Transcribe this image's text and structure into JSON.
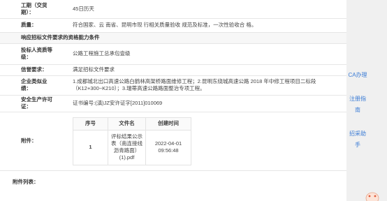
{
  "rows": {
    "duration_label": "工期（交货期）：",
    "duration_value": "45日历天",
    "quality_label": "质量：",
    "quality_value": "符合国家、云 南省、昆明市现 行相关质量验收 规范及标准，一次性验收合 格。",
    "section_title": "响应招标文件要求的资格能力条件",
    "qualification_label": "投标人资质等级：",
    "qualification_value": "公路工程施工总承包壹级",
    "credit_label": "信誉要求：",
    "credit_value": "满足招标文件要求",
    "performance_label": "企业类似业绩：",
    "performance_value": "1.成都城北出口高速公路白鹤林高架桥路面维修工程；2.昆明东绕城高速公路 2018 年中修工程项目二标段（K12+300~K210）；3.瑞蒂高速公路路面整治专项工程。",
    "safety_label": "安全生产许可证：",
    "safety_value": "证书编号:(滇)JZ安许证字[2011]010069",
    "attachment_label": "附件："
  },
  "attachments": {
    "headers": [
      "序号",
      "文件名",
      "创建时间"
    ],
    "items": [
      {
        "index": "1",
        "filename": "评标结果公示表（南连接线沥青路面）(1).pdf",
        "created": "2022-04-01 09:56:48"
      }
    ]
  },
  "attachment_list_label": "附件列表：",
  "side": {
    "ca_label": "CA办理",
    "register_label": "注册指南",
    "purchase_label": "招采助手"
  },
  "colors": {
    "link": "#3a7bd5",
    "border": "#e6e6e6"
  }
}
